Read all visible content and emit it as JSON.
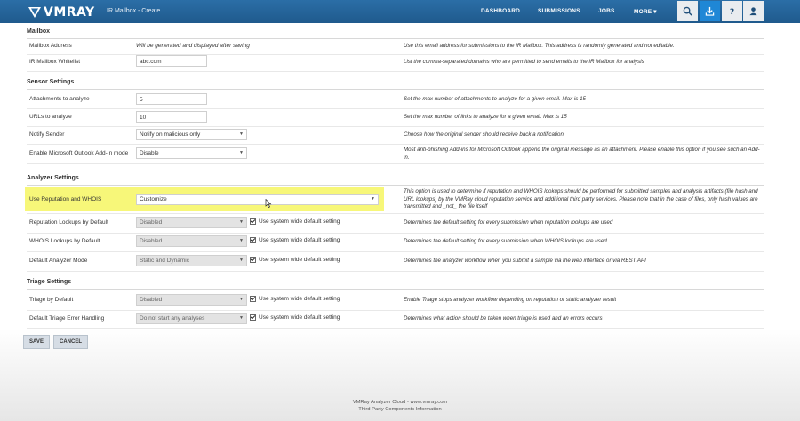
{
  "header": {
    "brand": "VMRAY",
    "breadcrumb": "IR Mailbox - Create",
    "nav": [
      "DASHBOARD",
      "SUBMISSIONS",
      "JOBS",
      "MORE ▾"
    ],
    "icons": [
      "search-icon",
      "download-icon",
      "help-icon",
      "user-icon"
    ],
    "accent": "#1f87d6"
  },
  "mailbox": {
    "section": "Mailbox",
    "address_label": "Mailbox Address",
    "address_value": "Will be generated and displayed after saving",
    "address_desc": "Use this email address for submissions to the IR Mailbox. This address is randomly generated and not editable.",
    "whitelist_label": "IR Mailbox Whitelist",
    "whitelist_value": "abc.com",
    "whitelist_desc": "List the comma-separated domains who are permitted to send emails to the IR Mailbox for analysis"
  },
  "sensor": {
    "section": "Sensor Settings",
    "attachments_label": "Attachments to analyze",
    "attachments_value": "5",
    "attachments_desc": "Set the max number of attachments to analyze for a given email. Max is 15",
    "urls_label": "URLs to analyze",
    "urls_value": "10",
    "urls_desc": "Set the max number of links to analyze for a given email. Max is 15",
    "notify_label": "Notify Sender",
    "notify_value": "Notify on malicious only",
    "notify_desc": "Choose how the original sender should receive back a notification.",
    "outlook_label": "Enable Microsoft Outlook Add-In mode",
    "outlook_value": "Disable",
    "outlook_desc": "Most anti-phishing Add-ins for Microsoft Outlook append the original message as an attachment. Please enable this option if you see such an Add-in."
  },
  "analyzer": {
    "section": "Analyzer Settings",
    "reputation_label": "Use Reputation and WHOIS",
    "reputation_value": "Customize",
    "reputation_desc": "This option is used to determine if reputation and WHOIS lookups should be performed for submitted samples and analysis artifacts (file hash and URL lookups) by the VMRay cloud reputation service and additional third party services. Please note that in the case of files, only hash values are transmitted and _not_ the file itself",
    "replookup_label": "Reputation Lookups by Default",
    "replookup_value": "Disabled",
    "replookup_desc": "Determines the default setting for every submission when reputation lookups are used",
    "whois_label": "WHOIS Lookups by Default",
    "whois_value": "Disabled",
    "whois_desc": "Determines the default setting for every submission when WHOIS lookups are used",
    "mode_label": "Default Analyzer Mode",
    "mode_value": "Static and Dynamic",
    "mode_desc": "Determines the analyzer workflow when you submit a sample via the web interface or via REST API",
    "system_default": "Use system wide default setting",
    "highlight": "#f6f66a"
  },
  "triage": {
    "section": "Triage Settings",
    "default_label": "Triage by Default",
    "default_value": "Disabled",
    "default_desc": "Enable Triage stops analyzer workflow depending on reputation or static analyzer result",
    "error_label": "Default Triage Error Handling",
    "error_value": "Do not start any analyses",
    "error_desc": "Determines what action should be taken when triage is used and an errors occurs"
  },
  "buttons": {
    "save": "SAVE",
    "cancel": "CANCEL"
  },
  "footer": {
    "line1": "VMRay Analyzer Cloud - www.vmray.com",
    "line2": "Third Party Components Information"
  }
}
